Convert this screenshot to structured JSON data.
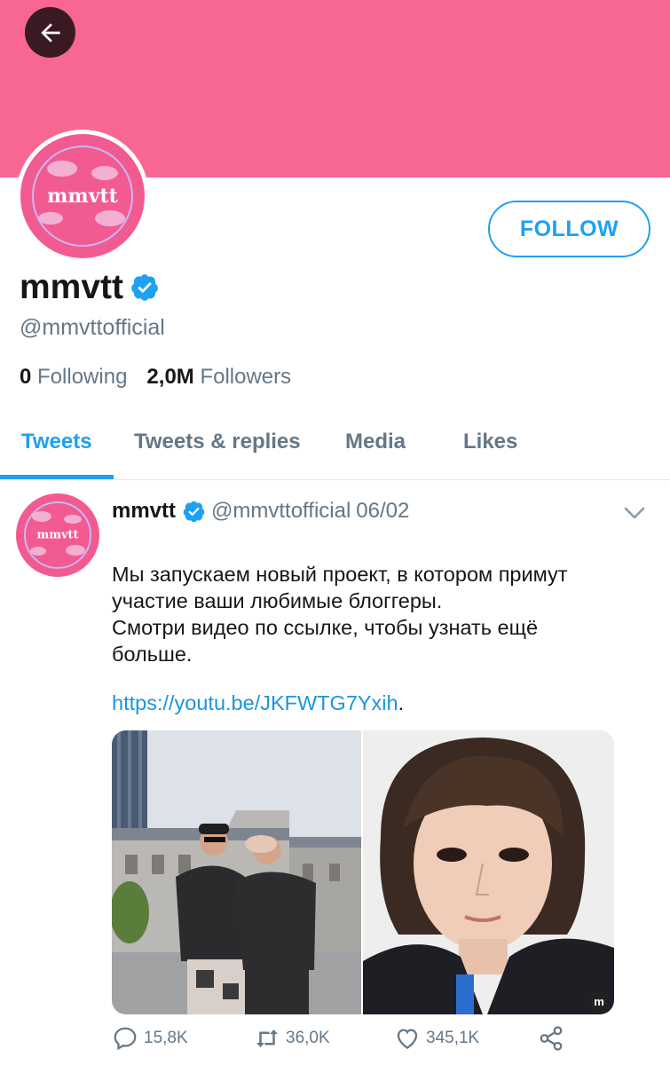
{
  "header": {
    "banner_color": "#f76791",
    "back_icon": "arrow-left-icon"
  },
  "profile": {
    "avatar_text": "mmvtt",
    "display_name": "mmvtt",
    "verified_icon": "verified-badge-icon",
    "handle": "@mmvttofficial",
    "follow_label": "FOLLOW",
    "following_count": "0",
    "following_label": "Following",
    "followers_count": "2,0M",
    "followers_label": "Followers"
  },
  "tabs": [
    {
      "label": "Tweets",
      "active": true
    },
    {
      "label": "Tweets & replies",
      "active": false
    },
    {
      "label": "Media",
      "active": false
    },
    {
      "label": "Likes",
      "active": false
    }
  ],
  "tweet": {
    "avatar_text": "mmvtt",
    "name": "mmvtt",
    "handle": "@mmvttofficial",
    "date": "06/02",
    "text_lines": [
      "Мы запускаем новый проект, в котором примут",
      "участие ваши любимые блоггеры.",
      "Смотри видео по ссылке, чтобы узнать ещё",
      "больше."
    ],
    "link": "https://youtu.be/JKFWTG7Yxih",
    "link_suffix": ".",
    "media_badge": "m",
    "actions": {
      "replies": "15,8K",
      "retweets": "36,0K",
      "likes": "345,1K"
    }
  },
  "colors": {
    "accent": "#1da1f2",
    "secondary_text": "#657786",
    "avatar_pink": "#f25a92"
  }
}
